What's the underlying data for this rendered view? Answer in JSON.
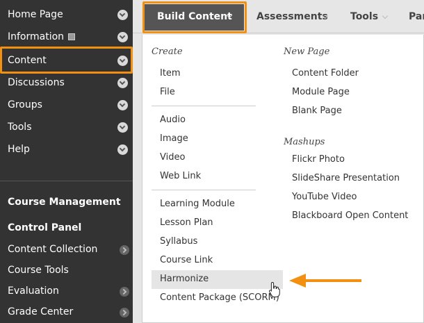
{
  "sidebar": {
    "items": [
      {
        "label": "Home Page"
      },
      {
        "label": "Information"
      },
      {
        "label": "Content"
      },
      {
        "label": "Discussions"
      },
      {
        "label": "Groups"
      },
      {
        "label": "Tools"
      },
      {
        "label": "Help"
      }
    ],
    "course_management": "Course Management",
    "control_panel": "Control Panel",
    "sub_items": [
      {
        "label": "Content Collection"
      },
      {
        "label": "Course Tools"
      },
      {
        "label": "Evaluation"
      },
      {
        "label": "Grade Center"
      }
    ]
  },
  "topbar": {
    "tabs": [
      {
        "label": "Build Content"
      },
      {
        "label": "Assessments"
      },
      {
        "label": "Tools"
      },
      {
        "label": "Par"
      }
    ]
  },
  "dropdown": {
    "create_title": "Create",
    "create_items": [
      "Item",
      "File"
    ],
    "media_items": [
      "Audio",
      "Image",
      "Video",
      "Web Link"
    ],
    "learning_items": [
      "Learning Module",
      "Lesson Plan",
      "Syllabus",
      "Course Link",
      "Harmonize",
      "Content Package (SCORM)"
    ],
    "new_page_title": "New Page",
    "new_page_items": [
      "Content Folder",
      "Module Page",
      "Blank Page"
    ],
    "mashups_title": "Mashups",
    "mashups_items": [
      "Flickr Photo",
      "SlideShare Presentation",
      "YouTube Video",
      "Blackboard Open Content"
    ]
  },
  "colors": {
    "accent_orange": "#f29111",
    "sidebar_bg": "#333333",
    "tab_active_bg": "#555555"
  }
}
